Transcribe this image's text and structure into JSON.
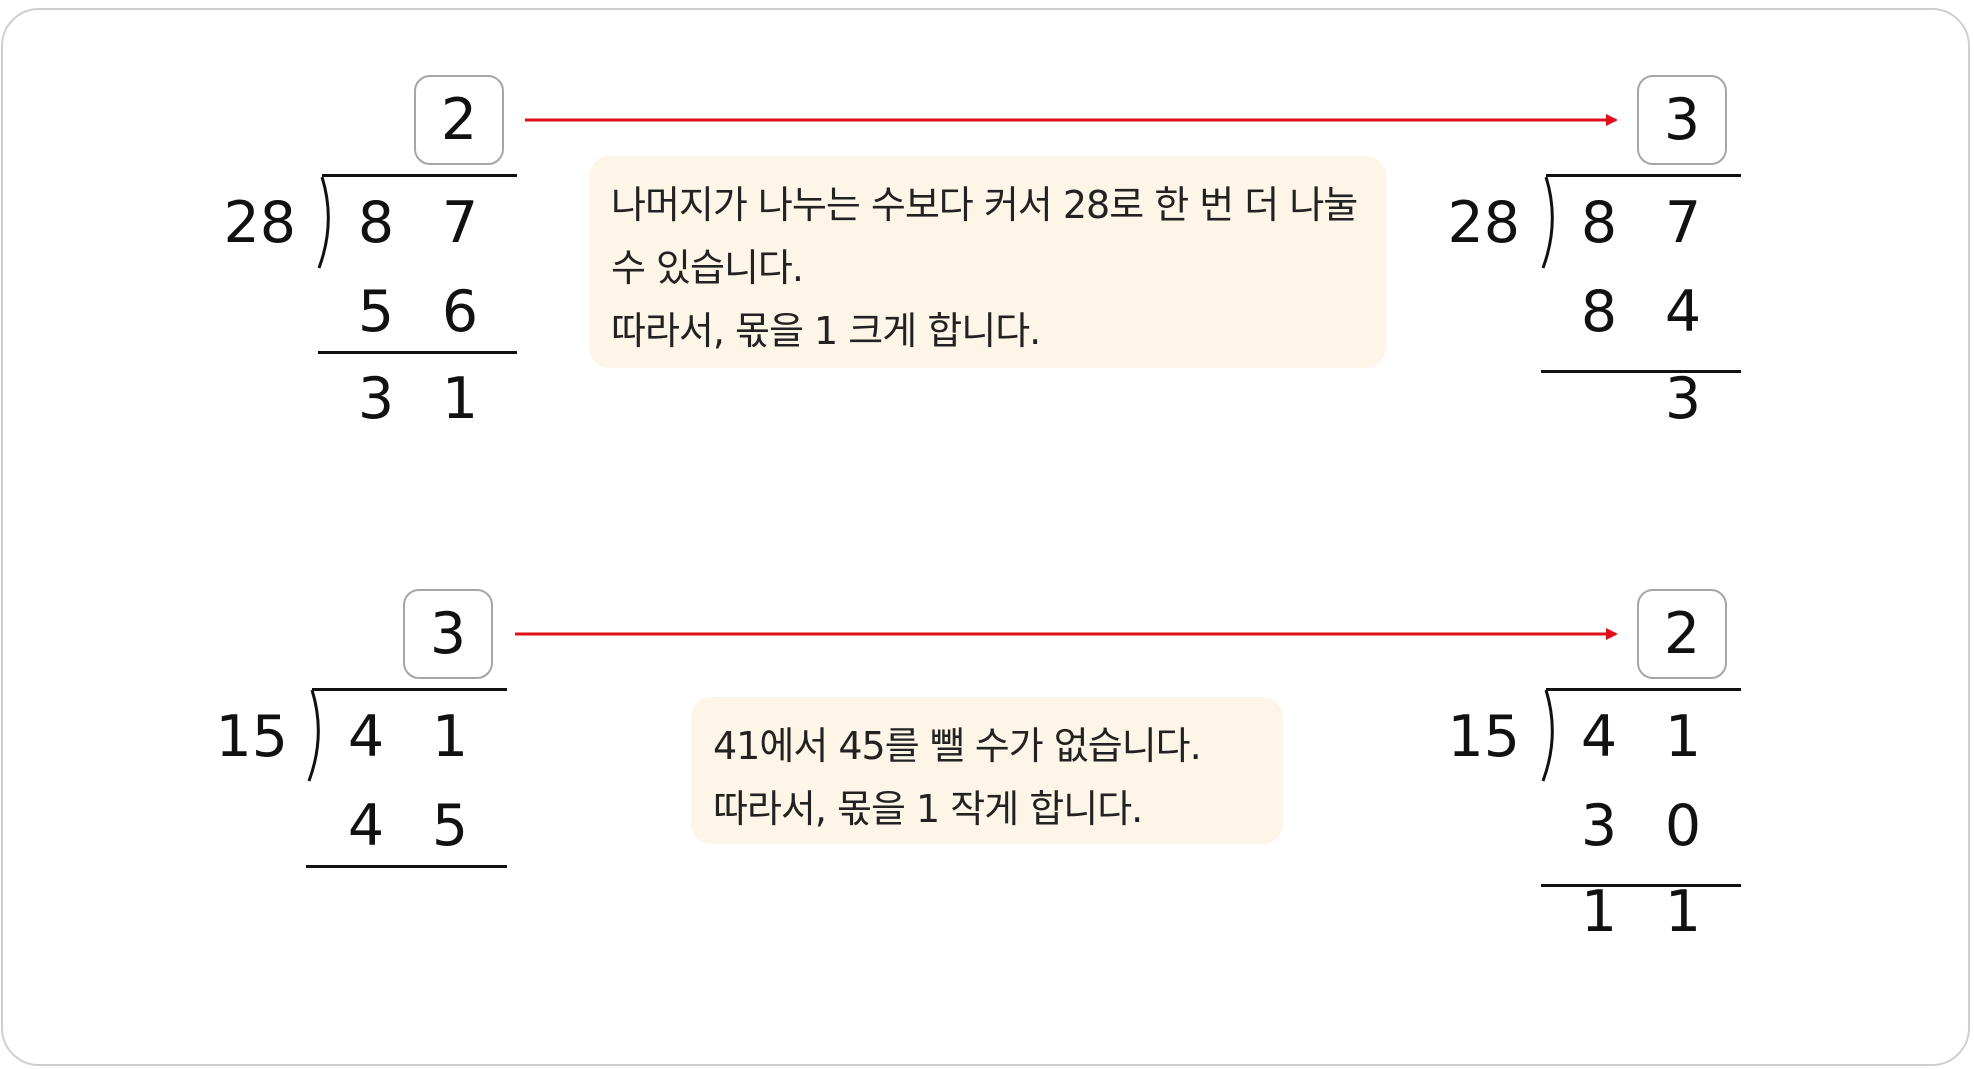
{
  "problem1": {
    "left": {
      "quotient": "2",
      "divisor": "28",
      "dividend": [
        "8",
        "7"
      ],
      "product": [
        "5",
        "6"
      ],
      "remainder": [
        "3",
        "1"
      ]
    },
    "note": {
      "lines": [
        "나머지가 나누는 수보다 커서 28로 한 번 더 나눌",
        "수 있습니다.",
        "따라서, 몫을 1 크게 합니다."
      ]
    },
    "right": {
      "quotient": "3",
      "divisor": "28",
      "dividend": [
        "8",
        "7"
      ],
      "product": [
        "8",
        "4"
      ],
      "remainder": [
        "",
        "3"
      ]
    }
  },
  "problem2": {
    "left": {
      "quotient": "3",
      "divisor": "15",
      "dividend": [
        "4",
        "1"
      ],
      "product": [
        "4",
        "5"
      ]
    },
    "note": {
      "lines": [
        "41에서 45를 뺄 수가 없습니다.",
        "따라서, 몫을 1 작게 합니다."
      ]
    },
    "right": {
      "quotient": "2",
      "divisor": "15",
      "dividend": [
        "4",
        "1"
      ],
      "product": [
        "3",
        "0"
      ],
      "remainder": [
        "1",
        "1"
      ]
    }
  },
  "colors": {
    "arrow": "#e0101a",
    "note_background": "#fdf5e8",
    "quotient_box_border": "#a6a6a6"
  }
}
